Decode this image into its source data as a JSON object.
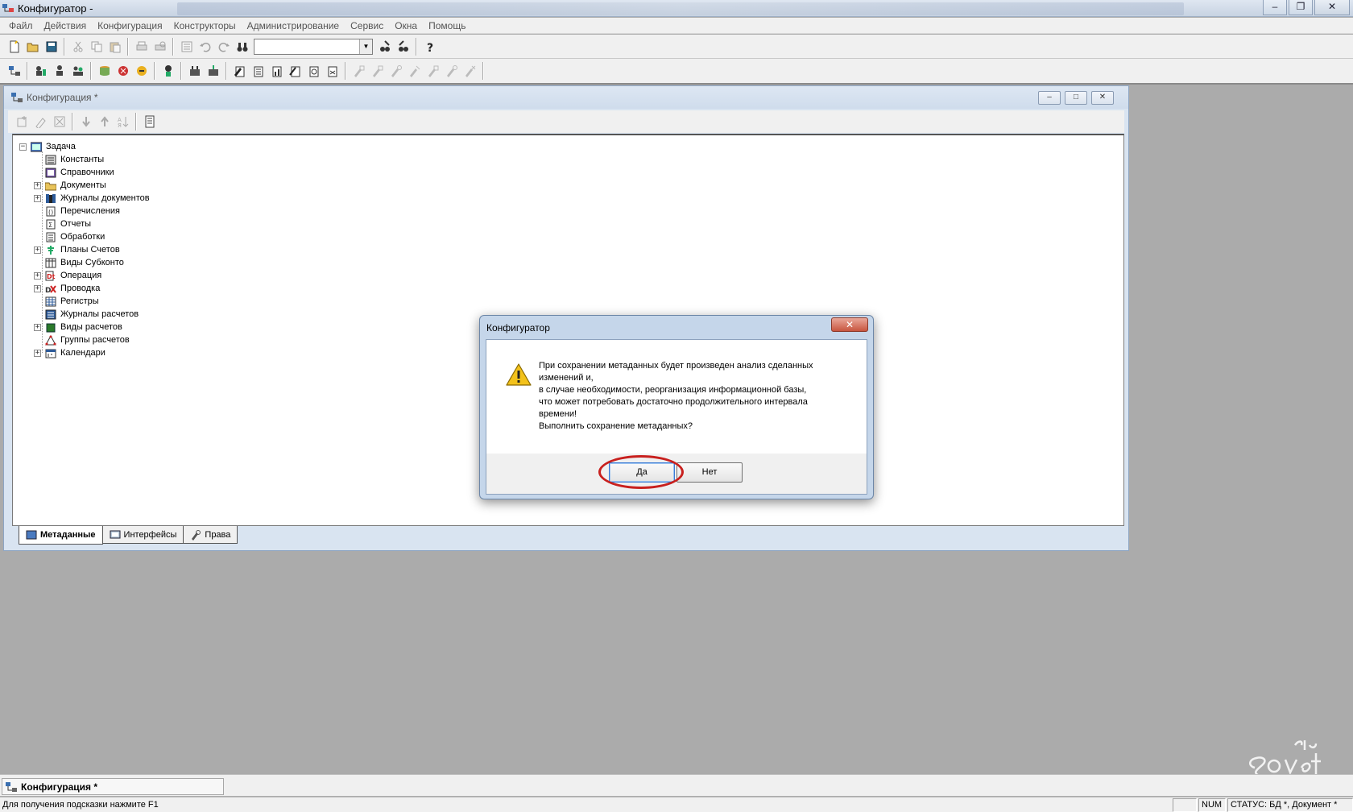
{
  "app": {
    "title": "Конфигуратор -"
  },
  "menu": [
    "Файл",
    "Действия",
    "Конфигурация",
    "Конструкторы",
    "Администрирование",
    "Сервис",
    "Окна",
    "Помощь"
  ],
  "mdi": {
    "title": "Конфигурация *",
    "btn_min": "–",
    "btn_max": "□",
    "btn_close": "✕"
  },
  "tree": {
    "root": "Задача",
    "items": [
      {
        "label": "Константы",
        "expandable": false
      },
      {
        "label": "Справочники",
        "expandable": false
      },
      {
        "label": "Документы",
        "expandable": true
      },
      {
        "label": "Журналы документов",
        "expandable": true
      },
      {
        "label": "Перечисления",
        "expandable": false
      },
      {
        "label": "Отчеты",
        "expandable": false
      },
      {
        "label": "Обработки",
        "expandable": false
      },
      {
        "label": "Планы Счетов",
        "expandable": true
      },
      {
        "label": "Виды Субконто",
        "expandable": false
      },
      {
        "label": "Операция",
        "expandable": true
      },
      {
        "label": "Проводка",
        "expandable": true
      },
      {
        "label": "Регистры",
        "expandable": false
      },
      {
        "label": "Журналы расчетов",
        "expandable": false
      },
      {
        "label": "Виды расчетов",
        "expandable": true
      },
      {
        "label": "Группы расчетов",
        "expandable": false
      },
      {
        "label": "Календари",
        "expandable": true
      }
    ]
  },
  "tabs": [
    "Метаданные",
    "Интерфейсы",
    "Права"
  ],
  "dialog": {
    "title": "Конфигуратор",
    "close": "✕",
    "lines": [
      "При сохранении метаданных будет произведен анализ сделанных",
      "изменений и,",
      "в случае необходимости, реорганизация информационной базы,",
      "что может потребовать  достаточно продолжительного интервала",
      "времени!",
      "Выполнить сохранение метаданных?"
    ],
    "yes": "Да",
    "no": "Нет"
  },
  "taskbar": {
    "window": "Конфигурация *"
  },
  "status": {
    "hint": "Для получения подсказки нажмите F1",
    "num": "NUM",
    "state": "СТАТУС: БД *, Документ *"
  },
  "colors": {
    "highlight_ring": "#c8201e",
    "dialog_frame": "#c5d6ea",
    "workspace": "#ababab"
  }
}
